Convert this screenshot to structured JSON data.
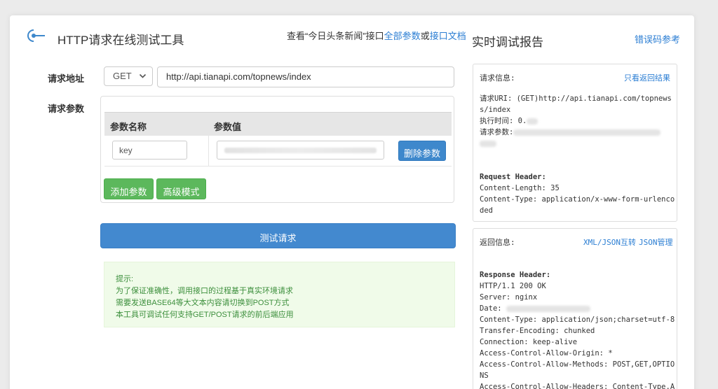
{
  "header": {
    "app_title": "HTTP请求在线测试工具",
    "doc_prefix": "查看“今日头条新闻”接口",
    "all_params_link": "全部参数",
    "or_text": "或",
    "api_doc_link": "接口文档"
  },
  "form": {
    "url_label": "请求地址",
    "method_value": "GET",
    "url_value": "http://api.tianapi.com/topnews/index",
    "params_label": "请求参数",
    "param_name_header": "参数名称",
    "param_value_header": "参数值",
    "param_key_value": "key",
    "delete_button": "删除参数",
    "add_button": "添加参数",
    "advanced_button": "高级模式",
    "test_button": "测试请求"
  },
  "tips": {
    "title": "提示:",
    "lines": [
      "为了保证准确性，调用接口的过程基于真实环境请求",
      "需要发送BASE64等大文本内容请切换到POST方式",
      "本工具可调试任何支持GET/POST请求的前后端应用"
    ]
  },
  "report": {
    "title": "实时调试报告",
    "error_code_link": "错误码参考",
    "request_panel": {
      "title": "请求信息:",
      "toggle_link": "只看返回结果",
      "uri_line1": "请求URI: (GET)http://api.tianapi.com/topnews",
      "uri_line2": "s/index",
      "exec_time": "执行时间: 0.",
      "req_params": "请求参数:",
      "header_title": "Request Header:",
      "content_length": "Content-Length: 35",
      "content_type_1": "Content-Type: application/x-www-form-urlenco",
      "content_type_2": "ded"
    },
    "response_panel": {
      "title": "返回信息:",
      "xml_json_link": "XML/JSON互转",
      "json_manage_link": "JSON管理",
      "header_title": "Response Header:",
      "lines": [
        "HTTP/1.1 200 OK",
        "Server: nginx",
        "Date: ",
        "Content-Type: application/json;charset=utf-8",
        "Transfer-Encoding: chunked",
        "Connection: keep-alive",
        "Access-Control-Allow-Origin: *",
        "Access-Control-Allow-Methods: POST,GET,OPTIO",
        "NS",
        "Access-Control-Allow-Headers: Content-Type,A"
      ]
    }
  },
  "colors": {
    "link": "#2b7ed3",
    "primary_button": "#4389cf",
    "success_button": "#5cb85c",
    "tips_background": "#f0fbe9"
  }
}
